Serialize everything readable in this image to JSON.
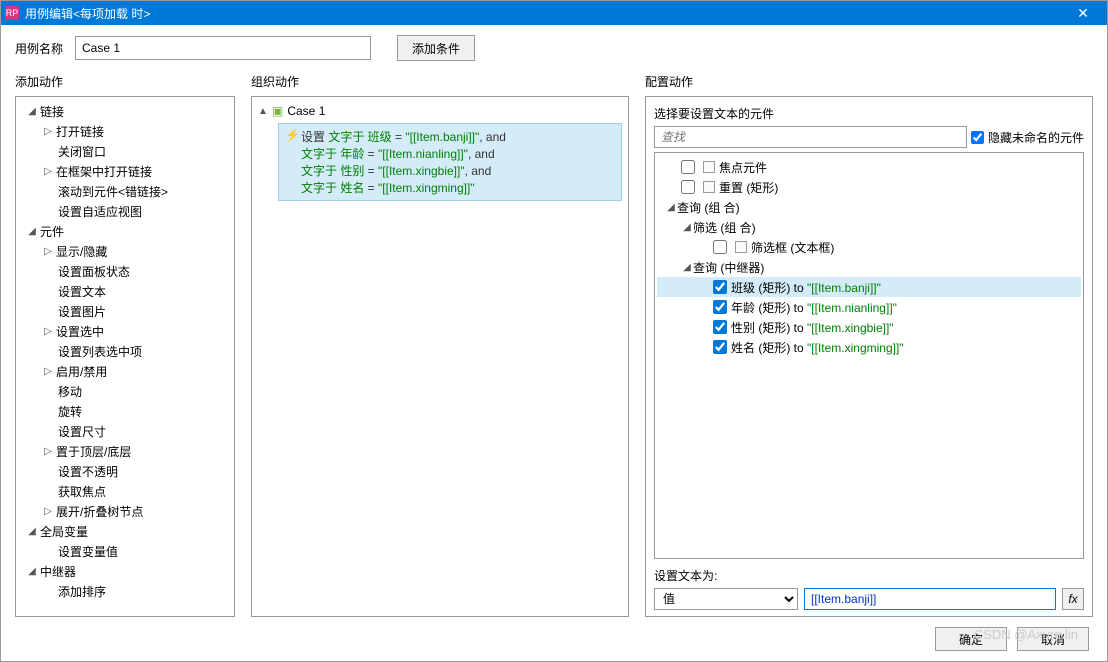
{
  "titlebar": {
    "app_icon": "RP",
    "title": "用例编辑<每项加载 时>"
  },
  "top": {
    "label": "用例名称",
    "case_name": "Case 1",
    "add_condition": "添加条件"
  },
  "headers": {
    "add_action": "添加动作",
    "organize": "组织动作",
    "configure": "配置动作"
  },
  "add_tree": [
    {
      "t": "g",
      "l": "链接",
      "c": [
        {
          "t": "s",
          "l": "打开链接"
        },
        {
          "t": "l",
          "l": "关闭窗口"
        },
        {
          "t": "s",
          "l": "在框架中打开链接"
        },
        {
          "t": "l",
          "l": "滚动到元件<错链接>"
        },
        {
          "t": "l",
          "l": "设置自适应视图"
        }
      ]
    },
    {
      "t": "g",
      "l": "元件",
      "c": [
        {
          "t": "s",
          "l": "显示/隐藏"
        },
        {
          "t": "l",
          "l": "设置面板状态"
        },
        {
          "t": "l",
          "l": "设置文本"
        },
        {
          "t": "l",
          "l": "设置图片"
        },
        {
          "t": "s",
          "l": "设置选中"
        },
        {
          "t": "l",
          "l": "设置列表选中项"
        },
        {
          "t": "s",
          "l": "启用/禁用"
        },
        {
          "t": "l",
          "l": "移动"
        },
        {
          "t": "l",
          "l": "旋转"
        },
        {
          "t": "l",
          "l": "设置尺寸"
        },
        {
          "t": "s",
          "l": "置于顶层/底层"
        },
        {
          "t": "l",
          "l": "设置不透明"
        },
        {
          "t": "l",
          "l": "获取焦点"
        },
        {
          "t": "s",
          "l": "展开/折叠树节点"
        }
      ]
    },
    {
      "t": "g",
      "l": "全局变量",
      "c": [
        {
          "t": "l",
          "l": "设置变量值"
        }
      ]
    },
    {
      "t": "g",
      "l": "中继器",
      "c": [
        {
          "t": "l",
          "l": "添加排序"
        }
      ]
    }
  ],
  "case_block": {
    "name": "Case 1",
    "lines": [
      {
        "pre": "设置 ",
        "a": "文字于 班级",
        "eq": " = ",
        "v": "\"[[Item.banji]]\"",
        "suf": ", and"
      },
      {
        "pre": "",
        "a": "文字于 年龄",
        "eq": " = ",
        "v": "\"[[Item.nianling]]\"",
        "suf": ", and"
      },
      {
        "pre": "",
        "a": "文字于 性别",
        "eq": " = ",
        "v": "\"[[Item.xingbie]]\"",
        "suf": ", and"
      },
      {
        "pre": "",
        "a": "文字于 姓名",
        "eq": " = ",
        "v": "\"[[Item.xingming]]\"",
        "suf": ""
      }
    ]
  },
  "config": {
    "sel_label": "选择要设置文本的元件",
    "search_placeholder": "查找",
    "hide_unnamed": "隐藏未命名的元件",
    "tree": {
      "focus": "焦点元件",
      "reset": "重置 (矩形)",
      "query_group": "查询 (组 合)",
      "filter_group": "筛选 (组 合)",
      "filter_box": "筛选框 (文本框)",
      "repeater": "查询 (中继器)",
      "items": [
        {
          "n": "班级 (矩形) to ",
          "v": "\"[[Item.banji]]\"",
          "sel": true
        },
        {
          "n": "年龄 (矩形) to ",
          "v": "\"[[Item.nianling]]\"",
          "sel": false
        },
        {
          "n": "性别 (矩形) to ",
          "v": "\"[[Item.xingbie]]\"",
          "sel": false
        },
        {
          "n": "姓名 (矩形) to ",
          "v": "\"[[Item.xingming]]\"",
          "sel": false
        }
      ]
    },
    "set_text_label": "设置文本为:",
    "value_option": "值",
    "value_input": "[[Item.banji]]",
    "fx": "fx"
  },
  "footer": {
    "ok": "确定",
    "cancel": "取消"
  },
  "watermark": "CSDN @Axure.lin"
}
